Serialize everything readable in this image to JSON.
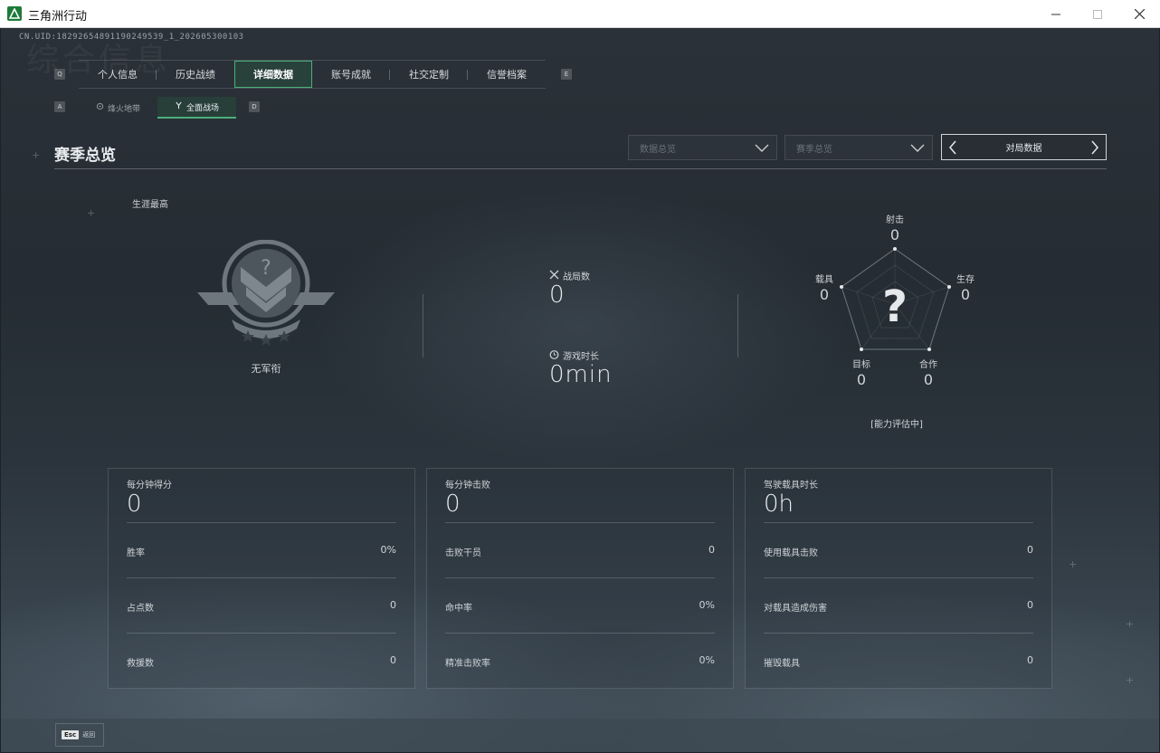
{
  "window": {
    "title": "三角洲行动",
    "controls": [
      "minimize",
      "maximize",
      "close"
    ]
  },
  "uid": "CN.UID:18292654891190249539_1_202605300103",
  "watermark": "综合信息",
  "main_tabs": {
    "left_key": "Q",
    "right_key": "E",
    "items": [
      {
        "label": "个人信息",
        "active": false
      },
      {
        "label": "历史战绩",
        "active": false
      },
      {
        "label": "详细数据",
        "active": true
      },
      {
        "label": "账号成就",
        "active": false
      },
      {
        "label": "社交定制",
        "active": false
      },
      {
        "label": "信誉档案",
        "active": false
      }
    ]
  },
  "sub_tabs": {
    "left_key": "A",
    "right_key": "D",
    "items": [
      {
        "label": "烽火地带",
        "icon": "flame-icon",
        "active": false
      },
      {
        "label": "全面战场",
        "icon": "crossed-arrows-icon",
        "active": true
      }
    ]
  },
  "section_title": "赛季总览",
  "filters": {
    "data_overview": "数据总览",
    "season_overview": "赛季总览",
    "switcher_label": "对局数据"
  },
  "career": {
    "label": "生涯最高",
    "rank_name": "无军衔"
  },
  "matches": {
    "label": "战局数",
    "value": "0"
  },
  "play_time": {
    "label": "游戏时长",
    "value": "0min"
  },
  "radar": {
    "axes": [
      {
        "key": "shoot",
        "label": "射击",
        "value": "0"
      },
      {
        "key": "survive",
        "label": "生存",
        "value": "0"
      },
      {
        "key": "coop",
        "label": "合作",
        "value": "0"
      },
      {
        "key": "target",
        "label": "目标",
        "value": "0"
      },
      {
        "key": "vehicle",
        "label": "载具",
        "value": "0"
      }
    ],
    "status": "[能力评估中]"
  },
  "cards": [
    {
      "title": "每分钟得分",
      "value": "0",
      "rows": [
        {
          "label": "胜率",
          "value": "0%"
        },
        {
          "label": "占点数",
          "value": "0"
        },
        {
          "label": "救援数",
          "value": "0"
        }
      ]
    },
    {
      "title": "每分钟击败",
      "value": "0",
      "rows": [
        {
          "label": "击败干员",
          "value": "0"
        },
        {
          "label": "命中率",
          "value": "0%"
        },
        {
          "label": "精准击败率",
          "value": "0%"
        }
      ]
    },
    {
      "title": "驾驶载具时长",
      "value": "0h",
      "rows": [
        {
          "label": "使用载具击败",
          "value": "0"
        },
        {
          "label": "对载具造成伤害",
          "value": "0"
        },
        {
          "label": "摧毁载具",
          "value": "0"
        }
      ]
    }
  ],
  "footer": {
    "esc_key": "Esc",
    "esc_label": "返回"
  },
  "colors": {
    "accent_green": "#4caf7a",
    "app_icon": "#1f7a3a"
  }
}
